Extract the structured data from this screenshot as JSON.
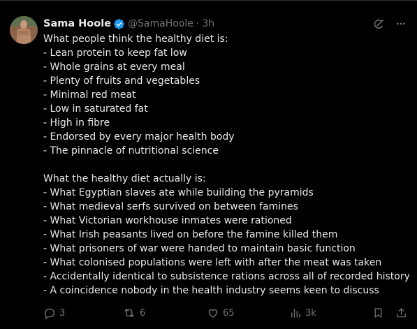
{
  "author": {
    "name": "Sama Hoole",
    "handle": "@SamaHoole",
    "separator": "·",
    "time": "3h"
  },
  "post": {
    "intro": "What people think the healthy diet is:",
    "list1": [
      "- Lean protein to keep fat low",
      "- Whole grains at every meal",
      "- Plenty of fruits and vegetables",
      "- Minimal red meat",
      "- Low in saturated fat",
      "- High in fibre",
      "- Endorsed by every major health body",
      "- The pinnacle of nutritional science"
    ],
    "intro2": "What the healthy diet actually is:",
    "list2": [
      "- What Egyptian slaves ate while building the pyramids",
      "- What medieval serfs survived on between famines",
      "- What Victorian workhouse inmates were rationed",
      "- What Irish peasants lived on before the famine killed them",
      "- What prisoners of war were handed to maintain basic function",
      "- What colonised populations were left with after the meat was taken",
      "- Accidentally identical to subsistence rations across all of recorded history",
      "- A coincidence nobody in the health industry seems keen to discuss"
    ]
  },
  "actions": {
    "replies": "3",
    "reposts": "6",
    "likes": "65",
    "views": "3k"
  },
  "icons": {
    "verified": "verified-badge-icon",
    "grok": "grok-icon",
    "more": "more-options-icon",
    "reply": "reply-icon",
    "repost": "repost-icon",
    "like": "like-icon",
    "views": "views-icon",
    "bookmark": "bookmark-icon",
    "share": "share-icon"
  },
  "colors": {
    "background": "#000000",
    "text": "#e7e9ea",
    "muted": "#71767b",
    "verified": "#1d9bf0"
  }
}
